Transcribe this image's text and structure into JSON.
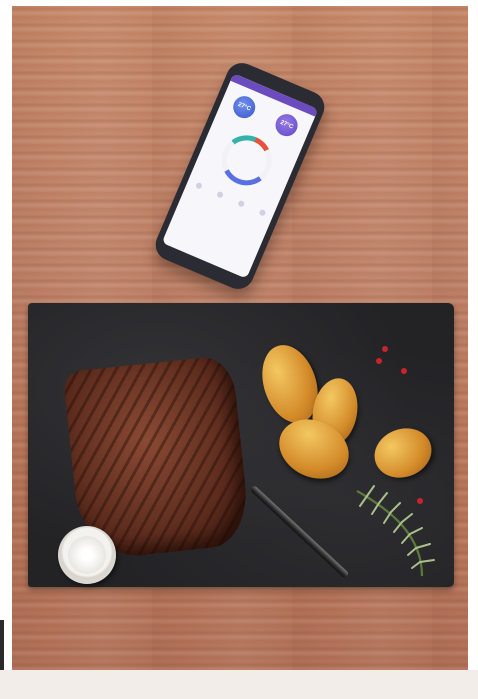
{
  "photo": {
    "description_colors": {
      "table": "#c0846a",
      "slate": "#232326",
      "potato": "#e0a040",
      "steak": "#6b3324"
    }
  },
  "phone_screen": {
    "temp_left": "27°C",
    "temp_right": "27°C"
  }
}
